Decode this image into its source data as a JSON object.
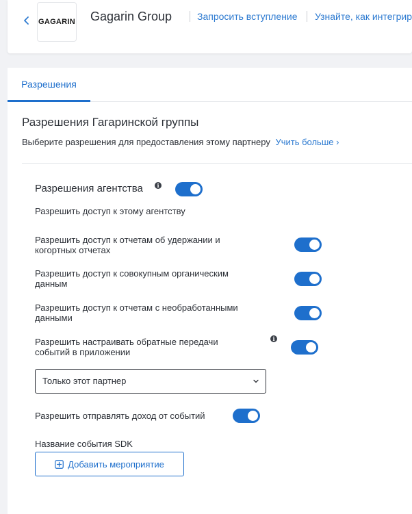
{
  "header": {
    "logo_text": "GAGARIN",
    "partner_name": "Gagarin Group",
    "links": [
      "Запросить вступление",
      "Узнайте, как интегрир"
    ]
  },
  "tabs": [
    {
      "label": "Разрешения",
      "active": true
    }
  ],
  "section": {
    "title": "Разрешения Гагаринской группы",
    "subtitle": "Выберите разрешения для предоставления этому партнеру",
    "learn_more": "Учить больше ›"
  },
  "agency": {
    "title": "Разрешения агентства",
    "enabled": true,
    "subtitle": "Разрешить доступ к этому агентству",
    "permissions": [
      {
        "line1": "Разрешить доступ к отчетам об удержании и",
        "line2": "когортных отчетах",
        "enabled": true
      },
      {
        "line1": "Разрешить доступ к совокупным органическим",
        "line2": "данным",
        "enabled": true
      },
      {
        "line1": "Разрешить доступ к отчетам с необработанными",
        "line2": "данными",
        "enabled": true
      },
      {
        "line1": "Разрешить настраивать обратные передачи",
        "line2": "событий в приложении",
        "enabled": true
      }
    ],
    "postback_scope": "Только этот партнер",
    "revenue_label": "Разрешить отправлять доход от событий",
    "revenue_enabled": true,
    "sdk_event_label": "Название события SDK",
    "add_event_button": "Добавить мероприятие"
  },
  "colors": {
    "accent": "#1e6fcc",
    "link": "#2e7bd1",
    "background": "#f1f2f5"
  }
}
